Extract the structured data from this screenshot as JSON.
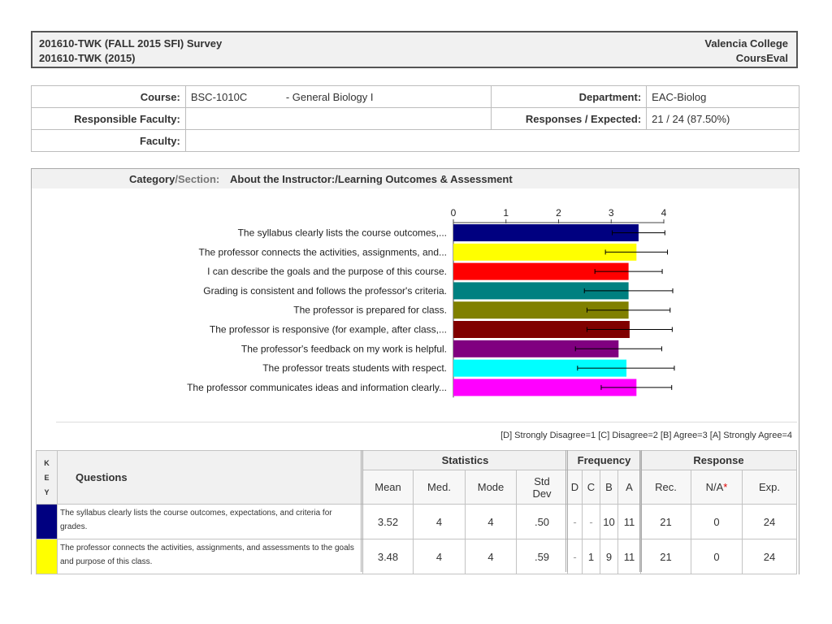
{
  "header": {
    "survey_title": "201610-TWK (FALL 2015 SFI) Survey",
    "term": "201610-TWK (2015)",
    "institution": "Valencia College",
    "system": "CoursEval"
  },
  "info": {
    "course_label": "Course:",
    "course_code": "BSC-1010C",
    "course_name": "- General Biology I",
    "department_label": "Department:",
    "department": "EAC-Biolog",
    "faculty_resp_label": "Responsible Faculty:",
    "faculty_resp": "",
    "responses_label": "Responses / Expected:",
    "responses": "21 / 24 (87.50%)",
    "faculty_label": "Faculty:",
    "faculty": ""
  },
  "section": {
    "prefix_a": "Category",
    "prefix_b": "/Section:",
    "name": "About the Instructor:/Learning Outcomes & Assessment"
  },
  "chart_data": {
    "type": "bar",
    "orientation": "horizontal",
    "xlim": [
      0,
      4
    ],
    "xticks": [
      "0",
      "1",
      "2",
      "3",
      "4"
    ],
    "categories": [
      "The syllabus clearly lists the course outcomes,...",
      "The professor connects the activities, assignments, and...",
      "I can describe the goals and the purpose of this course.",
      "Grading is consistent and follows the professor's criteria.",
      "The professor is prepared for class.",
      "The professor is responsive (for example, after class,...",
      "The professor's feedback on my work is helpful.",
      "The professor treats students with respect.",
      "The professor communicates ideas and information clearly..."
    ],
    "values": [
      3.52,
      3.48,
      3.33,
      3.33,
      3.33,
      3.35,
      3.14,
      3.29,
      3.48
    ],
    "std_dev": [
      0.5,
      0.59,
      0.64,
      0.84,
      0.79,
      0.81,
      0.82,
      0.93,
      0.67
    ],
    "colors": [
      "#000080",
      "#ffff00",
      "#ff0000",
      "#008080",
      "#808000",
      "#800000",
      "#800080",
      "#00ffff",
      "#ff00ff"
    ],
    "grid": false
  },
  "legend": {
    "text": "[D] Strongly Disagree=1 [C] Disagree=2 [B] Agree=3 [A] Strongly Agree=4"
  },
  "stats_table": {
    "key_letters": [
      "K",
      "E",
      "Y"
    ],
    "questions_header": "Questions",
    "statistics_header": "Statistics",
    "frequency_header": "Frequency",
    "response_header": "Response",
    "cols": {
      "mean": "Mean",
      "median": "Med.",
      "mode": "Mode",
      "std_a": "Std",
      "std_b": "Dev",
      "d": "D",
      "c": "C",
      "b": "B",
      "a": "A",
      "rec": "Rec.",
      "na": "N/A",
      "na_mark": "*",
      "exp": "Exp."
    },
    "rows": [
      {
        "color": "#000080",
        "question": "The syllabus clearly lists the course outcomes, expectations, and criteria for grades.",
        "mean": "3.52",
        "median": "4",
        "mode": "4",
        "std": ".50",
        "d": "-",
        "c": "-",
        "b": "10",
        "a": "11",
        "rec": "21",
        "na": "0",
        "exp": "24"
      },
      {
        "color": "#ffff00",
        "question": "The professor connects the activities, assignments, and assessments to the goals and purpose of this class.",
        "mean": "3.48",
        "median": "4",
        "mode": "4",
        "std": ".59",
        "d": "-",
        "c": "1",
        "b": "9",
        "a": "11",
        "rec": "21",
        "na": "0",
        "exp": "24"
      }
    ]
  }
}
